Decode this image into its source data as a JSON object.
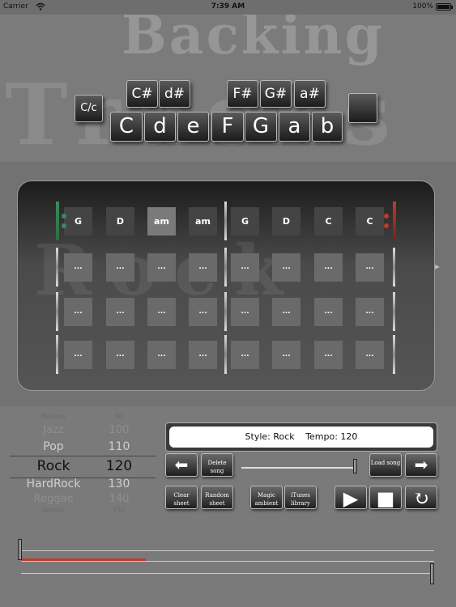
{
  "status_bar": {
    "carrier": "Carrier",
    "time": "7:39 AM",
    "battery": "100%"
  },
  "header": {
    "title_word_1": "Backing",
    "title_word_2": "Tracks",
    "key_cc": "C/c",
    "sharps": [
      "C#",
      "d#",
      "F#",
      "G#",
      "a#"
    ],
    "naturals": [
      "C",
      "d",
      "e",
      "F",
      "G",
      "a",
      "b"
    ]
  },
  "grid": {
    "watermark": "Rock",
    "rows": [
      [
        "G",
        "D",
        "am",
        "am",
        "G",
        "D",
        "C",
        "C"
      ],
      [
        "...",
        "...",
        "...",
        "...",
        "...",
        "...",
        "...",
        "..."
      ],
      [
        "...",
        "...",
        "...",
        "...",
        "...",
        "...",
        "...",
        "..."
      ],
      [
        "...",
        "...",
        "...",
        "...",
        "...",
        "...",
        "...",
        "..."
      ]
    ],
    "colors": {
      "repeat_start": "#3a8c5a",
      "repeat_end": "#c0392b",
      "accent_line": "#c0392b"
    }
  },
  "style_picker": {
    "rows": [
      {
        "name": "Ballade",
        "tempo": "90"
      },
      {
        "name": "Jazz",
        "tempo": "100"
      },
      {
        "name": "Pop",
        "tempo": "110"
      },
      {
        "name": "Rock",
        "tempo": "120"
      },
      {
        "name": "HardRock",
        "tempo": "130"
      },
      {
        "name": "Reggae",
        "tempo": "140"
      },
      {
        "name": "Techno",
        "tempo": "150"
      }
    ],
    "selected_index": 3
  },
  "info": {
    "style": "Style: Rock",
    "tempo": "Tempo: 120"
  },
  "controls": {
    "prev_icon": "left-arrow-icon",
    "next_icon": "right-arrow-icon",
    "delete_song": "Delete song",
    "load_song": "Load song",
    "clear_sheet": "Clear sheet",
    "random_sheet": "Random sheet",
    "magic_ambient": "Magic ambient",
    "itunes_library": "iTunes library",
    "play_icon": "play-icon",
    "stop_icon": "stop-icon",
    "loop_icon": "repeat-icon",
    "play_glyph": "▶",
    "stop_glyph": "■",
    "loop_glyph": "↻",
    "left_glyph": "⬅",
    "right_glyph": "➡"
  }
}
